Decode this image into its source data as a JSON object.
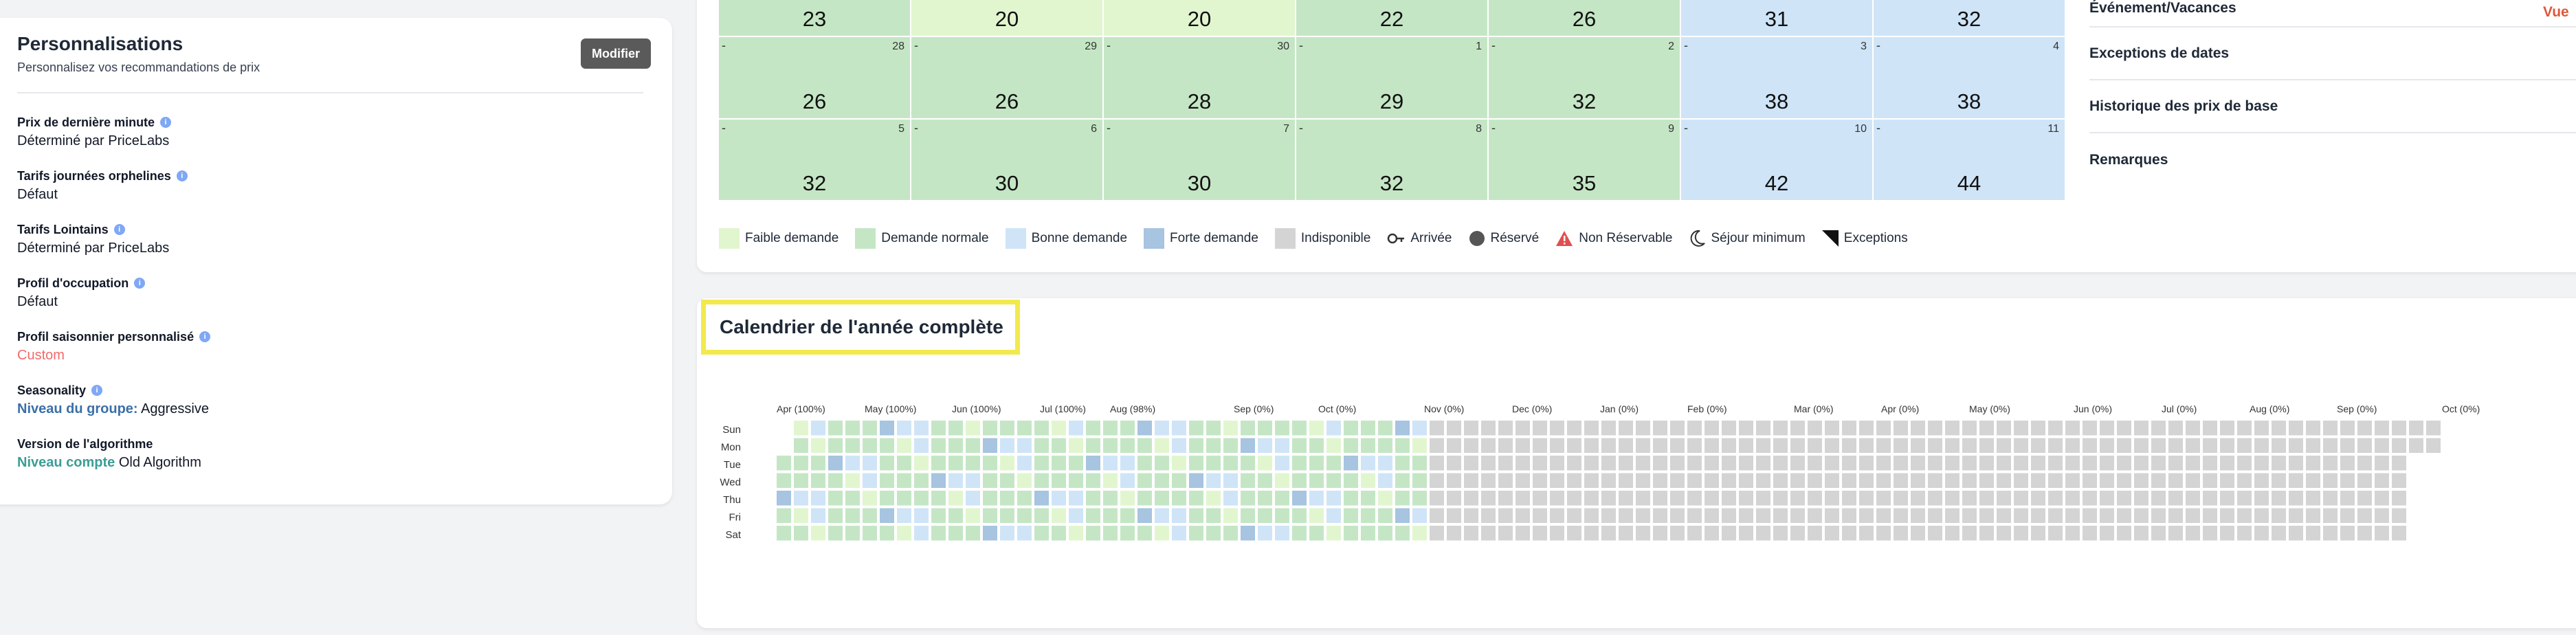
{
  "personalisations": {
    "title": "Personnalisations",
    "subtitle": "Personnalisez vos recommandations de prix",
    "modify_label": "Modifier",
    "settings": [
      {
        "label": "Prix de dernière minute",
        "value": "Déterminé par PriceLabs"
      },
      {
        "label": "Tarifs journées orphelines",
        "value": "Défaut"
      },
      {
        "label": "Tarifs Lointains",
        "value": "Déterminé par PriceLabs"
      },
      {
        "label": "Profil d'occupation",
        "value": "Défaut"
      },
      {
        "label": "Profil saisonnier personnalisé",
        "value": "Custom"
      },
      {
        "label": "Seasonality",
        "value_prefix": "Niveau du groupe:",
        "value": "Aggressive"
      },
      {
        "label": "Version de l'algorithme",
        "value_prefix": "Niveau compte",
        "value": "Old Algorithm"
      }
    ]
  },
  "calendar": {
    "rows": [
      [
        {
          "price": "23",
          "day": "",
          "demand": "normal"
        },
        {
          "price": "20",
          "day": "",
          "demand": "faible"
        },
        {
          "price": "20",
          "day": "",
          "demand": "faible"
        },
        {
          "price": "22",
          "day": "",
          "demand": "normal"
        },
        {
          "price": "26",
          "day": "",
          "demand": "normal"
        },
        {
          "price": "31",
          "day": "",
          "demand": "bonne"
        },
        {
          "price": "32",
          "day": "",
          "demand": "bonne"
        }
      ],
      [
        {
          "price": "26",
          "day": "28",
          "demand": "normal"
        },
        {
          "price": "26",
          "day": "29",
          "demand": "normal"
        },
        {
          "price": "28",
          "day": "30",
          "demand": "normal"
        },
        {
          "price": "29",
          "day": "1",
          "demand": "normal"
        },
        {
          "price": "32",
          "day": "2",
          "demand": "normal"
        },
        {
          "price": "38",
          "day": "3",
          "demand": "bonne"
        },
        {
          "price": "38",
          "day": "4",
          "demand": "bonne"
        }
      ],
      [
        {
          "price": "32",
          "day": "5",
          "demand": "normal"
        },
        {
          "price": "30",
          "day": "6",
          "demand": "normal"
        },
        {
          "price": "30",
          "day": "7",
          "demand": "normal"
        },
        {
          "price": "32",
          "day": "8",
          "demand": "normal"
        },
        {
          "price": "35",
          "day": "9",
          "demand": "normal"
        },
        {
          "price": "42",
          "day": "10",
          "demand": "bonne"
        },
        {
          "price": "44",
          "day": "11",
          "demand": "bonne"
        }
      ]
    ],
    "cell_dash": "-",
    "legend": [
      {
        "label": "Faible demande",
        "kind": "swatch",
        "color": "#e1f6cf"
      },
      {
        "label": "Demande normale",
        "kind": "swatch",
        "color": "#c5e6c5"
      },
      {
        "label": "Bonne demande",
        "kind": "swatch",
        "color": "#cfe4f7"
      },
      {
        "label": "Forte demande",
        "kind": "swatch",
        "color": "#a7c4e0"
      },
      {
        "label": "Indisponible",
        "kind": "swatch",
        "color": "#d4d4d4"
      },
      {
        "label": "Arrivée",
        "kind": "key-icon"
      },
      {
        "label": "Réservé",
        "kind": "dot-icon"
      },
      {
        "label": "Non Réservable",
        "kind": "warning-icon"
      },
      {
        "label": "Séjour minimum",
        "kind": "moon-icon"
      },
      {
        "label": "Exceptions",
        "kind": "corner-icon"
      }
    ]
  },
  "side_menu": {
    "items": [
      "Événement/Vacances",
      "Exceptions de dates",
      "Historique des prix de base",
      "Remarques"
    ],
    "vue_label": "Vue"
  },
  "year_calendar": {
    "title": "Calendrier de l'année complète",
    "weekdays": [
      "Sun",
      "Mon",
      "Tue",
      "Wed",
      "Thu",
      "Fri",
      "Sat"
    ],
    "months": [
      "Apr (100%)",
      "May (100%)",
      "Jun (100%)",
      "Jul (100%)",
      "Aug (98%)",
      "Sep (0%)",
      "Oct (0%)",
      "Nov (0%)",
      "Dec (0%)",
      "Jan (0%)",
      "Feb (0%)",
      "Mar (0%)",
      "Apr (0%)",
      "May (0%)",
      "Jun (0%)",
      "Jul (0%)",
      "Aug (0%)",
      "Sep (0%)",
      "Oct (0%)"
    ],
    "colors": {
      "faible": "#e1f6cf",
      "normal": "#c5e6c5",
      "bonne": "#cfe4f7",
      "forte": "#a7c4e0",
      "indisponible": "#d4d4d4"
    }
  }
}
